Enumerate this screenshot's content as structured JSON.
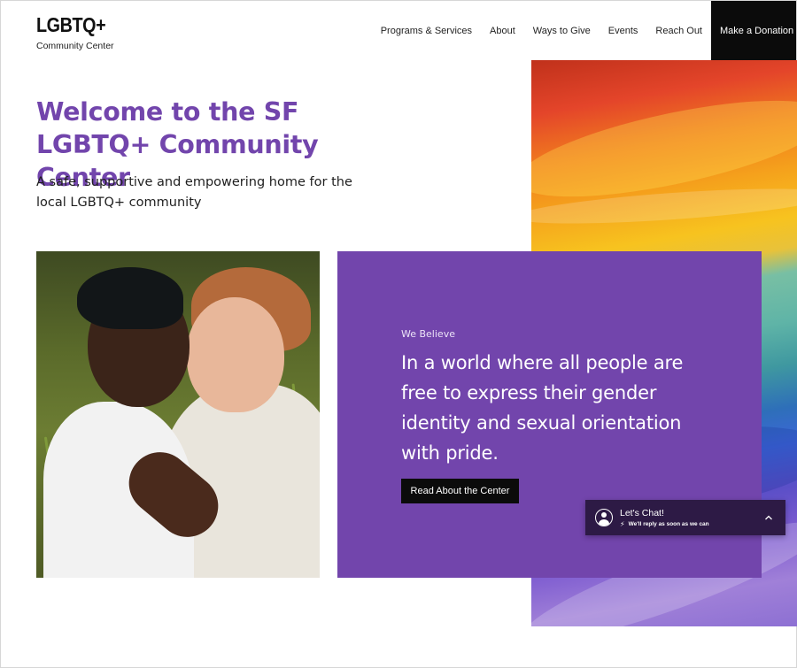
{
  "header": {
    "logo_title": "LGBTQ+",
    "logo_subtitle": "Community Center",
    "nav": [
      {
        "label": "Programs & Services"
      },
      {
        "label": "About"
      },
      {
        "label": "Ways to Give"
      },
      {
        "label": "Events"
      },
      {
        "label": "Reach Out"
      }
    ],
    "donate_label": "Make a Donation"
  },
  "hero": {
    "title": "Welcome to the SF LGBTQ+ Community Center",
    "subtitle": "A safe, supportive and empowering home for the local LGBTQ+ community"
  },
  "believe": {
    "kicker": "We Believe",
    "text": "In a world where all people are free to express their gender identity and sexual orientation with pride.",
    "button_label": "Read About the Center"
  },
  "chat": {
    "title": "Let's Chat!",
    "subtitle": "We'll reply as soon as we can",
    "avatar_icon": "user-avatar-icon",
    "bolt_icon": "lightning-icon",
    "chevron_icon": "chevron-up-icon"
  },
  "colors": {
    "accent_purple": "#7245ac",
    "dark": "#0b0b0b",
    "chat_bg": "#2d1a45"
  }
}
